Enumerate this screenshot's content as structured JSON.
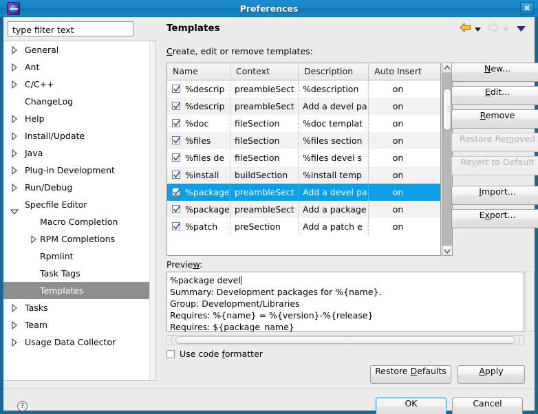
{
  "window": {
    "title": "Preferences",
    "app_icon": "eclipse-icon",
    "close_label": "✖"
  },
  "sidebar": {
    "filter": {
      "value": "type filter text",
      "placeholder": "type filter text"
    },
    "items": [
      {
        "label": "General",
        "indent": 0,
        "expander": "closed"
      },
      {
        "label": "Ant",
        "indent": 0,
        "expander": "closed"
      },
      {
        "label": "C/C++",
        "indent": 0,
        "expander": "closed"
      },
      {
        "label": "ChangeLog",
        "indent": 0,
        "expander": "none"
      },
      {
        "label": "Help",
        "indent": 0,
        "expander": "closed"
      },
      {
        "label": "Install/Update",
        "indent": 0,
        "expander": "closed"
      },
      {
        "label": "Java",
        "indent": 0,
        "expander": "closed"
      },
      {
        "label": "Plug-in Development",
        "indent": 0,
        "expander": "closed"
      },
      {
        "label": "Run/Debug",
        "indent": 0,
        "expander": "closed"
      },
      {
        "label": "Specfile Editor",
        "indent": 0,
        "expander": "open"
      },
      {
        "label": "Macro Completion",
        "indent": 1,
        "expander": "none"
      },
      {
        "label": "RPM Completions",
        "indent": 1,
        "expander": "closed"
      },
      {
        "label": "Rpmlint",
        "indent": 1,
        "expander": "none"
      },
      {
        "label": "Task Tags",
        "indent": 1,
        "expander": "none"
      },
      {
        "label": "Templates",
        "indent": 1,
        "expander": "none",
        "selected": true
      },
      {
        "label": "Tasks",
        "indent": 0,
        "expander": "closed"
      },
      {
        "label": "Team",
        "indent": 0,
        "expander": "closed"
      },
      {
        "label": "Usage Data Collector",
        "indent": 0,
        "expander": "closed"
      }
    ]
  },
  "page": {
    "title": "Templates",
    "nav": {
      "back_icon": "back-arrow-icon",
      "back_menu_icon": "chevron-down-icon",
      "forward_icon": "forward-arrow-icon",
      "forward_menu_icon": "chevron-down-icon",
      "menu_icon": "view-menu-icon"
    },
    "section_label": "Create, edit or remove templates:",
    "section_label_mnemonic": "C",
    "section_label_rest": "reate, edit or remove templates:"
  },
  "table": {
    "columns": [
      "Name",
      "Context",
      "Description",
      "Auto Insert"
    ],
    "rows": [
      {
        "checked": true,
        "name": "%descrip",
        "context": "preambleSect",
        "description": "%description",
        "auto_insert": "on",
        "selected": false
      },
      {
        "checked": true,
        "name": "%descrip",
        "context": "preambleSect",
        "description": "Add a devel pa",
        "auto_insert": "on",
        "selected": false
      },
      {
        "checked": true,
        "name": "%doc",
        "context": "fileSection",
        "description": "%doc templat",
        "auto_insert": "on",
        "selected": false
      },
      {
        "checked": true,
        "name": "%files",
        "context": "fileSection",
        "description": "%files section",
        "auto_insert": "on",
        "selected": false
      },
      {
        "checked": true,
        "name": "%files de",
        "context": "fileSection",
        "description": "%files devel s",
        "auto_insert": "on",
        "selected": false
      },
      {
        "checked": true,
        "name": "%install",
        "context": "buildSection",
        "description": "%install temp",
        "auto_insert": "on",
        "selected": false
      },
      {
        "checked": true,
        "name": "%package",
        "context": "preambleSect",
        "description": "Add a devel pa",
        "auto_insert": "on",
        "selected": true
      },
      {
        "checked": true,
        "name": "%package",
        "context": "preambleSect",
        "description": "Add a package",
        "auto_insert": "on",
        "selected": false
      },
      {
        "checked": true,
        "name": "%patch",
        "context": "preSection",
        "description": "Add a patch e",
        "auto_insert": "on",
        "selected": false
      }
    ],
    "scrollbar": {
      "up_icon": "scroll-up-icon",
      "down_icon": "scroll-down-icon",
      "thumb": "scroll-thumb"
    }
  },
  "side_buttons": [
    {
      "label": "New...",
      "mnemonic": "N",
      "enabled": true
    },
    {
      "label": "Edit...",
      "mnemonic": "E",
      "enabled": true
    },
    {
      "label": "Remove",
      "mnemonic": "R",
      "enabled": true
    },
    {
      "label": "Restore Removed",
      "mnemonic": "m",
      "enabled": false
    },
    {
      "label": "Revert to Default",
      "mnemonic": "v",
      "enabled": false
    },
    {
      "label": "Import...",
      "mnemonic": "I",
      "enabled": true
    },
    {
      "label": "Export...",
      "mnemonic": "x",
      "enabled": true
    }
  ],
  "preview": {
    "label": "Preview:",
    "label_pre": "Previe",
    "label_mnemonic": "w",
    "label_post": ":",
    "line1": "%package devel",
    "line2": "Summary: Development packages for %{name}.",
    "line3": "Group: Development/Libraries",
    "line4": "Requires: %{name} = %{version}-%{release}",
    "line5": "Requires: ${package_name}"
  },
  "code_formatter": {
    "label": "Use code formatter",
    "label_pre": "Use code ",
    "label_mnemonic": "f",
    "label_post": "ormatter",
    "checked": false
  },
  "footer": {
    "restore_defaults": {
      "pre": "Restore ",
      "mnemonic": "D",
      "post": "efaults"
    },
    "apply": {
      "pre": "",
      "mnemonic": "A",
      "post": "pply"
    },
    "ok": "OK",
    "cancel": "Cancel",
    "help_icon": "help-icon",
    "help_glyph": "?"
  },
  "colors": {
    "titlebar": "#1787c8",
    "window_border": "#1a6792",
    "selection": "#0d9ee8",
    "tree_selection": "#8f8f8f",
    "background": "#ececec"
  }
}
